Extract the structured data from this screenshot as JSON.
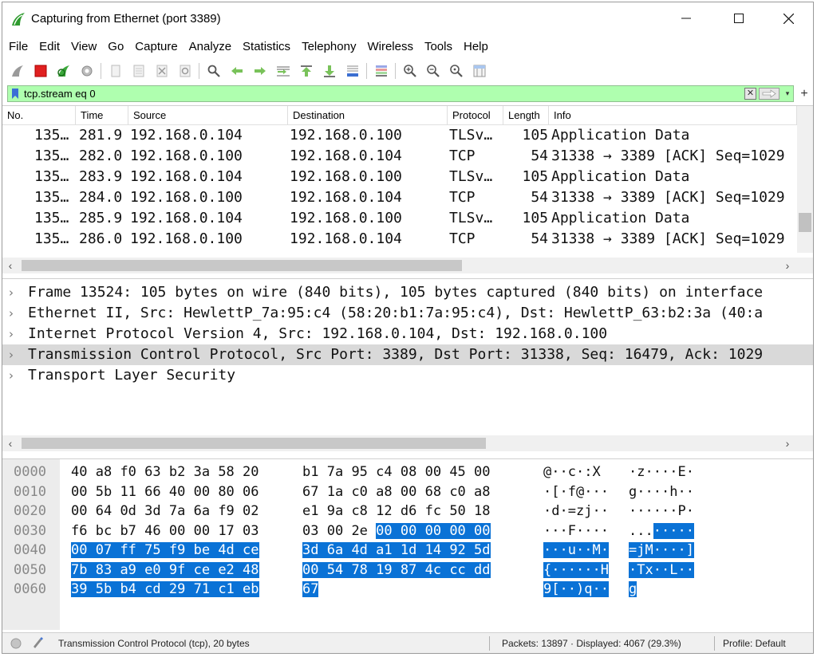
{
  "window": {
    "title": "Capturing from Ethernet (port 3389)",
    "accent": "#2e9b2e"
  },
  "menu": [
    "File",
    "Edit",
    "View",
    "Go",
    "Capture",
    "Analyze",
    "Statistics",
    "Telephony",
    "Wireless",
    "Tools",
    "Help"
  ],
  "toolbar": {
    "buttons": [
      "start-capture-icon",
      "stop-capture-icon",
      "restart-capture-icon",
      "capture-options-icon",
      "open-file-icon",
      "save-file-icon",
      "close-file-icon",
      "reload-file-icon",
      "find-packet-icon",
      "go-back-icon",
      "go-forward-icon",
      "go-to-packet-icon",
      "go-first-icon",
      "go-last-icon",
      "autoscroll-icon",
      "colorize-icon",
      "zoom-in-icon",
      "zoom-out-icon",
      "zoom-normal-icon",
      "resize-columns-icon"
    ]
  },
  "filter": {
    "value": "tcp.stream eq 0",
    "color": "#afffaf"
  },
  "packet_list": {
    "columns": [
      "No.",
      "Time",
      "Source",
      "Destination",
      "Protocol",
      "Length",
      "Info"
    ],
    "rows": [
      {
        "no": "135…",
        "time": "281.9",
        "src": "192.168.0.104",
        "dst": "192.168.0.100",
        "proto": "TLSv…",
        "len": "105",
        "info": "Application Data"
      },
      {
        "no": "135…",
        "time": "282.0",
        "src": "192.168.0.100",
        "dst": "192.168.0.104",
        "proto": "TCP",
        "len": "54",
        "info": "31338 → 3389 [ACK] Seq=1029"
      },
      {
        "no": "135…",
        "time": "283.9",
        "src": "192.168.0.104",
        "dst": "192.168.0.100",
        "proto": "TLSv…",
        "len": "105",
        "info": "Application Data"
      },
      {
        "no": "135…",
        "time": "284.0",
        "src": "192.168.0.100",
        "dst": "192.168.0.104",
        "proto": "TCP",
        "len": "54",
        "info": "31338 → 3389 [ACK] Seq=1029"
      },
      {
        "no": "135…",
        "time": "285.9",
        "src": "192.168.0.104",
        "dst": "192.168.0.100",
        "proto": "TLSv…",
        "len": "105",
        "info": "Application Data"
      },
      {
        "no": "135…",
        "time": "286.0",
        "src": "192.168.0.100",
        "dst": "192.168.0.104",
        "proto": "TCP",
        "len": "54",
        "info": "31338 → 3389 [ACK] Seq=1029"
      }
    ]
  },
  "details": {
    "rows": [
      {
        "text": "Frame 13524: 105 bytes on wire (840 bits), 105 bytes captured (840 bits) on interface",
        "selected": false
      },
      {
        "text": "Ethernet II, Src: HewlettP_7a:95:c4 (58:20:b1:7a:95:c4), Dst: HewlettP_63:b2:3a (40:a",
        "selected": false
      },
      {
        "text": "Internet Protocol Version 4, Src: 192.168.0.104, Dst: 192.168.0.100",
        "selected": false
      },
      {
        "text": "Transmission Control Protocol, Src Port: 3389, Dst Port: 31338, Seq: 16479, Ack: 1029",
        "selected": true
      },
      {
        "text": "Transport Layer Security",
        "selected": false
      }
    ]
  },
  "bytes": {
    "highlight_color": "#0a72d6",
    "rows": [
      {
        "offset": "0000",
        "hex": [
          "40 a8 f0 63 b2 3a 58 20",
          "b1 7a 95 c4 08 00 45 00"
        ],
        "ascii": [
          "@··c·:X ",
          "·z····E·"
        ],
        "hl_start": -1
      },
      {
        "offset": "0010",
        "hex": [
          "00 5b 11 66 40 00 80 06",
          "67 1a c0 a8 00 68 c0 a8"
        ],
        "ascii": [
          "·[·f@···",
          "g····h··"
        ],
        "hl_start": -1
      },
      {
        "offset": "0020",
        "hex": [
          "00 64 0d 3d 7a 6a f9 02",
          "e1 9a c8 12 d6 fc 50 18"
        ],
        "ascii": [
          "·d·=zj··",
          "······P·"
        ],
        "hl_start": -1
      },
      {
        "offset": "0030",
        "hex": [
          "f6 bc b7 46 00 00 17 03",
          "03 00 2e 00 00 00 00 00"
        ],
        "ascii": [
          "···F····",
          "...·····"
        ],
        "hl_start": 11
      },
      {
        "offset": "0040",
        "hex": [
          "00 07 ff 75 f9 be 4d ce",
          "3d 6a 4d a1 1d 14 92 5d"
        ],
        "ascii": [
          "···u··M·",
          "=jM····]"
        ],
        "hl_start": 0
      },
      {
        "offset": "0050",
        "hex": [
          "7b 83 a9 e0 9f ce e2 48",
          "00 54 78 19 87 4c cc dd"
        ],
        "ascii": [
          "{······H",
          "·Tx··L··"
        ],
        "hl_start": 0
      },
      {
        "offset": "0060",
        "hex": [
          "39 5b b4 cd 29 71 c1 eb",
          "67"
        ],
        "ascii": [
          "9[··)q··",
          "g"
        ],
        "hl_start": 0
      }
    ]
  },
  "status": {
    "info": "Transmission Control Protocol (tcp), 20 bytes",
    "packets": "Packets: 13897 · Displayed: 4067 (29.3%)",
    "profile": "Profile: Default"
  }
}
